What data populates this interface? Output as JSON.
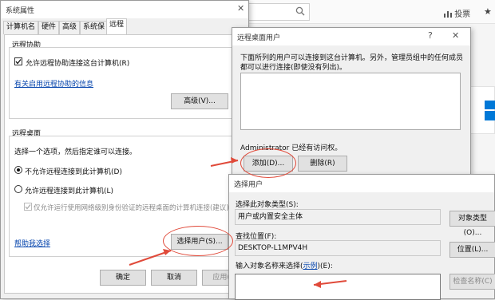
{
  "background": {
    "vote_label": "投票",
    "star_glyph": "★",
    "bottom_q": "?",
    "icons": [
      "search-icon",
      "bar-chart-icon",
      "star-icon",
      "windows-logo"
    ]
  },
  "sys_props": {
    "title": "系统属性",
    "close": "✕",
    "tabs": [
      "计算机名",
      "硬件",
      "高级",
      "系统保护",
      "远程"
    ],
    "remote_assist": {
      "group_title": "远程协助",
      "checkbox_label": "允许远程协助连接这台计算机(R)",
      "checkbox_checked": true,
      "info_link": "有关启用远程协助的信息",
      "advanced_button": "高级(V)..."
    },
    "remote_desktop": {
      "group_title": "远程桌面",
      "instruction": "选择一个选项，然后指定谁可以连接。",
      "option_1": "不允许远程连接到此计算机(D)",
      "option_2": "允许远程连接到此计算机(L)",
      "sub_option": "仅允许运行使用网络级别身份验证的远程桌面的计算机连接(建议)(N)",
      "selected_option": 1,
      "help_link": "帮助我选择",
      "select_users_button": "选择用户(S)..."
    },
    "buttons": {
      "ok": "确定",
      "cancel": "取消",
      "apply": "应用(A)"
    }
  },
  "rd_users": {
    "title": "远程桌面用户",
    "help": "?",
    "close": "✕",
    "description": "下面所列的用户可以连接到这台计算机。另外，管理员组中的任何成员都可以进行连接(即使没有列出)。",
    "access_text": "Administrator 已经有访问权。",
    "add_button": "添加(D)...",
    "remove_button": "删除(R)"
  },
  "select_users": {
    "title": "选择用户",
    "object_type_label": "选择此对象类型(S):",
    "object_type_value": "用户或内置安全主体",
    "object_type_button": "对象类型(O)...",
    "location_label": "查找位置(F):",
    "location_value": "DESKTOP-L1MPV4H",
    "location_button": "位置(L)...",
    "names_label_prefix": "输入对象名称来选择(",
    "names_label_link": "示例",
    "names_label_suffix": ")(E):",
    "names_value": "",
    "check_names_button": "检查名称(C)"
  },
  "annotation_color": "#e04a3a"
}
